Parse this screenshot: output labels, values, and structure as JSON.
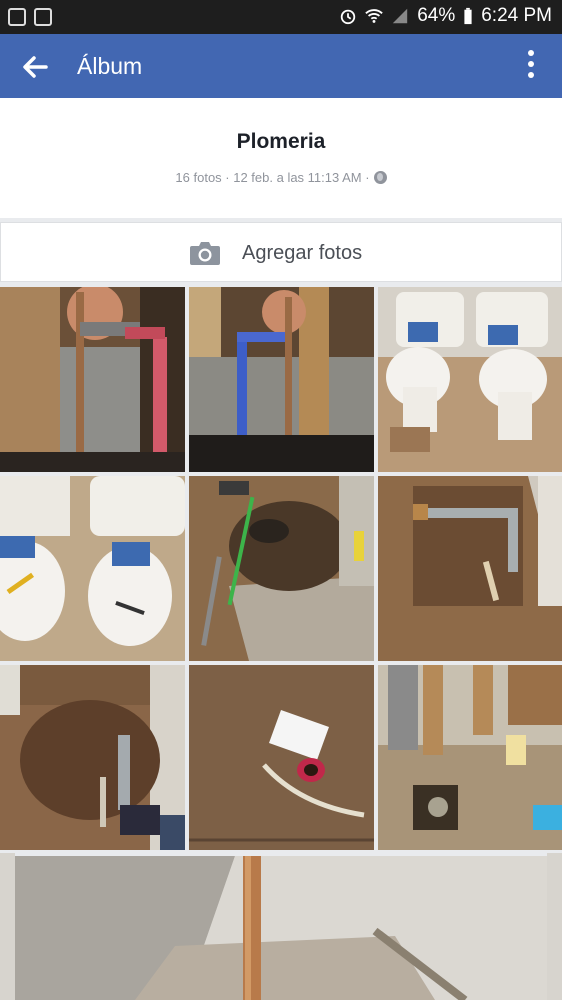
{
  "status_bar": {
    "battery": "64%",
    "time": "6:24 PM"
  },
  "app_bar": {
    "title": "Álbum"
  },
  "album": {
    "title": "Plomeria",
    "meta": "16 fotos · 12 feb. a las 11:13 AM ·"
  },
  "add_photos": {
    "label": "Agregar fotos"
  },
  "photos": [
    {
      "kind": "wall-pipes-copper"
    },
    {
      "kind": "wall-pipes-blue"
    },
    {
      "kind": "toilets"
    },
    {
      "kind": "toilets-close"
    },
    {
      "kind": "trench-hose"
    },
    {
      "kind": "trench-pvc"
    },
    {
      "kind": "trench-pipe"
    },
    {
      "kind": "floor-box"
    },
    {
      "kind": "floor-drain"
    }
  ],
  "colors": {
    "accent": "#4267b2",
    "status": "#1e1e1e"
  }
}
